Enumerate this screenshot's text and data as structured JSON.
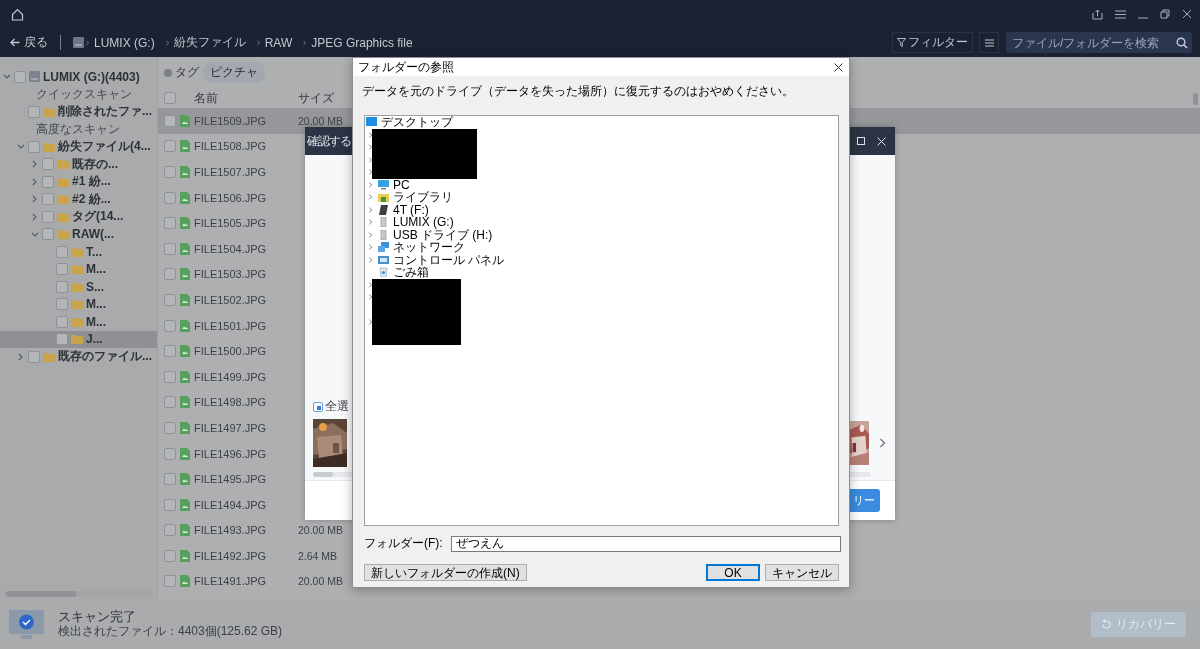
{
  "app": {
    "back": "戻る",
    "breadcrumbs": [
      "LUMIX (G:)",
      "紛失ファイル",
      "RAW",
      "JPEG Graphics file"
    ],
    "filter": "フィルター",
    "search": {
      "placeholder": "ファイル/フォルダーを検索"
    }
  },
  "sidebar": {
    "tree": [
      {
        "kind": "drive",
        "label": "LUMIX (G:)(4403)",
        "expanded": true,
        "checked": false,
        "selected": false,
        "children": [
          {
            "kind": "heading",
            "label": "クイックスキャン"
          },
          {
            "kind": "folder",
            "label": "削除されたファ...",
            "checked": false,
            "selected": false
          },
          {
            "kind": "heading",
            "label": "高度なスキャン"
          },
          {
            "kind": "folder",
            "label": "紛失ファイル(4...",
            "expanded": true,
            "checked": false,
            "selected": false,
            "children": [
              {
                "kind": "folder",
                "label": "既存の...",
                "expanded": false,
                "checked": false,
                "selected": false
              },
              {
                "kind": "folder",
                "label": "#1 紛...",
                "expanded": false,
                "checked": false,
                "selected": false
              },
              {
                "kind": "folder",
                "label": "#2 紛...",
                "expanded": false,
                "checked": false,
                "selected": false
              },
              {
                "kind": "folder",
                "label": "タグ(14...",
                "expanded": false,
                "checked": false,
                "selected": false
              },
              {
                "kind": "folder",
                "label": "RAW(...",
                "expanded": true,
                "checked": false,
                "selected": false,
                "children": [
                  {
                    "kind": "folder",
                    "label": "T...",
                    "checked": false,
                    "selected": false
                  },
                  {
                    "kind": "folder",
                    "label": "M...",
                    "checked": false,
                    "selected": false
                  },
                  {
                    "kind": "folder",
                    "label": "S...",
                    "checked": false,
                    "selected": false
                  },
                  {
                    "kind": "folder",
                    "label": "M...",
                    "checked": false,
                    "selected": false
                  },
                  {
                    "kind": "folder",
                    "label": "M...",
                    "checked": false,
                    "selected": false
                  },
                  {
                    "kind": "folder",
                    "label": "J...",
                    "checked": false,
                    "selected": true
                  }
                ]
              }
            ]
          },
          {
            "kind": "folder",
            "label": "既存のファイル...",
            "expanded": false,
            "checked": false,
            "selected": false
          }
        ]
      }
    ]
  },
  "file_list": {
    "tag_label": "タグ",
    "tag_chip": "ピクチャ",
    "columns": [
      "名前",
      "サイズ"
    ],
    "header_checked": false,
    "rows": [
      {
        "name": "FILE1509.JPG",
        "size": "20.00 MB",
        "checked": false,
        "selected": true
      },
      {
        "name": "FILE1508.JPG",
        "checked": false,
        "selected": false
      },
      {
        "name": "FILE1507.JPG",
        "checked": false,
        "selected": false
      },
      {
        "name": "FILE1506.JPG",
        "checked": false,
        "selected": false
      },
      {
        "name": "FILE1505.JPG",
        "checked": false,
        "selected": false
      },
      {
        "name": "FILE1504.JPG",
        "checked": false,
        "selected": false
      },
      {
        "name": "FILE1503.JPG",
        "checked": false,
        "selected": false
      },
      {
        "name": "FILE1502.JPG",
        "checked": false,
        "selected": false
      },
      {
        "name": "FILE1501.JPG",
        "checked": false,
        "selected": false
      },
      {
        "name": "FILE1500.JPG",
        "checked": false,
        "selected": false
      },
      {
        "name": "FILE1499.JPG",
        "checked": false,
        "selected": false
      },
      {
        "name": "FILE1498.JPG",
        "checked": false,
        "selected": false
      },
      {
        "name": "FILE1497.JPG",
        "checked": false,
        "selected": false
      },
      {
        "name": "FILE1496.JPG",
        "checked": false,
        "selected": false
      },
      {
        "name": "FILE1495.JPG",
        "checked": false,
        "selected": false
      },
      {
        "name": "FILE1494.JPG",
        "checked": false,
        "selected": false
      },
      {
        "name": "FILE1493.JPG",
        "size": "20.00 MB",
        "checked": false,
        "selected": false
      },
      {
        "name": "FILE1492.JPG",
        "size": "2.64 MB",
        "checked": false,
        "selected": false
      },
      {
        "name": "FILE1491.JPG",
        "size": "20.00 MB",
        "checked": false,
        "selected": false
      }
    ]
  },
  "status_bar": {
    "title": "スキャン完了",
    "detail": "検出されたファイル：4403個(125.62 GB)",
    "recover_button": {
      "label": "リカバリー",
      "disabled": true
    }
  },
  "confirm_dialog": {
    "title": "確認する",
    "select_all": {
      "label": "全選",
      "checked": true
    },
    "recover_button": "リー"
  },
  "folder_dialog": {
    "title": "フォルダーの参照",
    "message": "データを元のドライブ（データを失った場所）に復元するのはおやめください。",
    "tree": [
      {
        "kind": "desktop",
        "label": "デスクトップ",
        "expandable": false
      },
      {
        "kind": "redacted",
        "rows": [
          true,
          true,
          true,
          true
        ]
      },
      {
        "kind": "pc",
        "label": "PC",
        "expandable": true
      },
      {
        "kind": "library",
        "label": "ライブラリ",
        "expandable": true
      },
      {
        "kind": "disk",
        "label": "4T (F:)",
        "expandable": true
      },
      {
        "kind": "removable",
        "label": "LUMIX (G:)",
        "expandable": true
      },
      {
        "kind": "removable",
        "label": "USB ドライブ (H:)",
        "expandable": true
      },
      {
        "kind": "network",
        "label": "ネットワーク",
        "expandable": true
      },
      {
        "kind": "control-panel",
        "label": "コントロール パネル",
        "expandable": true
      },
      {
        "kind": "trash",
        "label": "ごみ箱",
        "expandable": false
      },
      {
        "kind": "redacted",
        "rows": [
          true,
          true,
          false,
          true,
          false
        ]
      }
    ],
    "folder_label": "フォルダー(F):",
    "folder_value": "ぜつえん",
    "buttons": [
      {
        "label": "新しいフォルダーの作成(N)",
        "default": false
      },
      {
        "label": "OK",
        "default": true
      },
      {
        "label": "キャンセル",
        "default": false
      }
    ]
  }
}
